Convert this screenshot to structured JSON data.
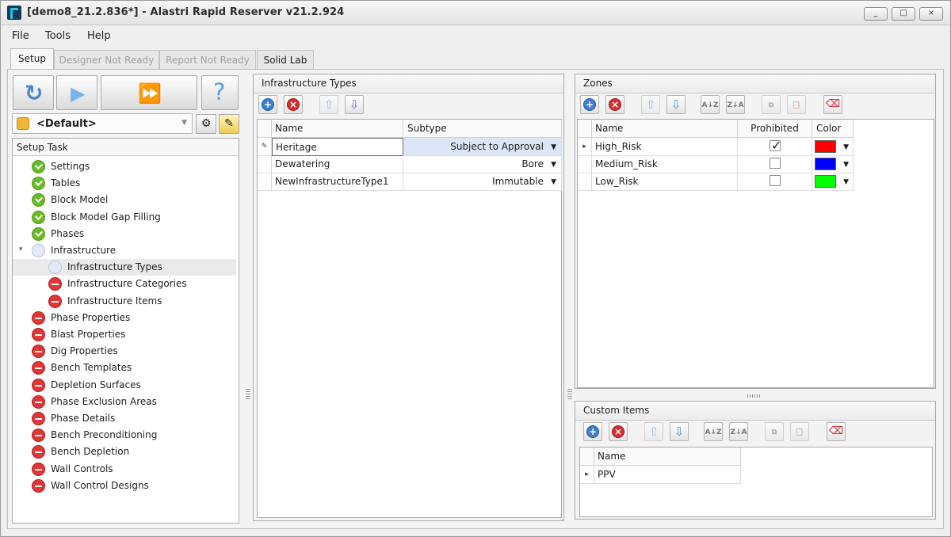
{
  "window": {
    "title": "[demo8_21.2.836*] - Alastri Rapid Reserver v21.2.924",
    "minimize": "_",
    "maximize": "□",
    "close": "×"
  },
  "menu": [
    "File",
    "Tools",
    "Help"
  ],
  "tabs": [
    {
      "label": "Setup",
      "state": "active"
    },
    {
      "label": "Designer Not Ready",
      "state": "disabled"
    },
    {
      "label": "Report Not Ready",
      "state": "disabled"
    },
    {
      "label": "Solid Lab",
      "state": "normal"
    }
  ],
  "profile": {
    "selected": "<Default>"
  },
  "setup_tasks": {
    "title": "Setup Task",
    "items": [
      {
        "label": "Settings",
        "status": "complete"
      },
      {
        "label": "Tables",
        "status": "complete"
      },
      {
        "label": "Block Model",
        "status": "complete"
      },
      {
        "label": "Block Model Gap Filling",
        "status": "complete"
      },
      {
        "label": "Phases",
        "status": "complete"
      },
      {
        "label": "Infrastructure",
        "status": "pending",
        "expanded": true
      },
      {
        "label": "Infrastructure Types",
        "status": "pending",
        "selected": true,
        "level": 2
      },
      {
        "label": "Infrastructure Categories",
        "status": "error",
        "level": 2
      },
      {
        "label": "Infrastructure Items",
        "status": "error",
        "level": 2
      },
      {
        "label": "Phase Properties",
        "status": "error"
      },
      {
        "label": "Blast Properties",
        "status": "error"
      },
      {
        "label": "Dig Properties",
        "status": "error"
      },
      {
        "label": "Bench Templates",
        "status": "error"
      },
      {
        "label": "Depletion Surfaces",
        "status": "error"
      },
      {
        "label": "Phase Exclusion Areas",
        "status": "error"
      },
      {
        "label": "Phase Details",
        "status": "error"
      },
      {
        "label": "Bench Preconditioning",
        "status": "error"
      },
      {
        "label": "Bench Depletion",
        "status": "error"
      },
      {
        "label": "Wall Controls",
        "status": "error"
      },
      {
        "label": "Wall Control Designs",
        "status": "error"
      }
    ]
  },
  "infrastructure_types": {
    "title": "Infrastructure Types",
    "columns": [
      "Name",
      "Subtype"
    ],
    "rows": [
      {
        "name": "Heritage",
        "subtype": "Subject to Approval",
        "editing": true
      },
      {
        "name": "Dewatering",
        "subtype": "Bore"
      },
      {
        "name": "NewInfrastructureType1",
        "subtype": "Immutable"
      }
    ]
  },
  "zones": {
    "title": "Zones",
    "columns": [
      "Name",
      "Prohibited",
      "Color"
    ],
    "rows": [
      {
        "name": "High_Risk",
        "prohibited": true,
        "color": "#ff0000",
        "current": true
      },
      {
        "name": "Medium_Risk",
        "prohibited": false,
        "color": "#0000ff"
      },
      {
        "name": "Low_Risk",
        "prohibited": false,
        "color": "#00ff00"
      }
    ]
  },
  "custom_items": {
    "title": "Custom Items",
    "columns": [
      "Name"
    ],
    "rows": [
      {
        "name": "PPV",
        "current": true
      }
    ]
  },
  "icons": {
    "refresh": "↻",
    "run": "▶",
    "run_all": "⏩",
    "help": "?",
    "settings": "⚙",
    "edit": "✎",
    "add": "+",
    "remove": "×",
    "up": "⇧",
    "down": "⇩",
    "sort_asc": "A↓Z",
    "sort_desc": "Z↓A",
    "copy": "⧉",
    "paste": "📋",
    "clear": "⌫",
    "row_pointer": "▸",
    "dropdown": "▼",
    "expand": "▾"
  }
}
